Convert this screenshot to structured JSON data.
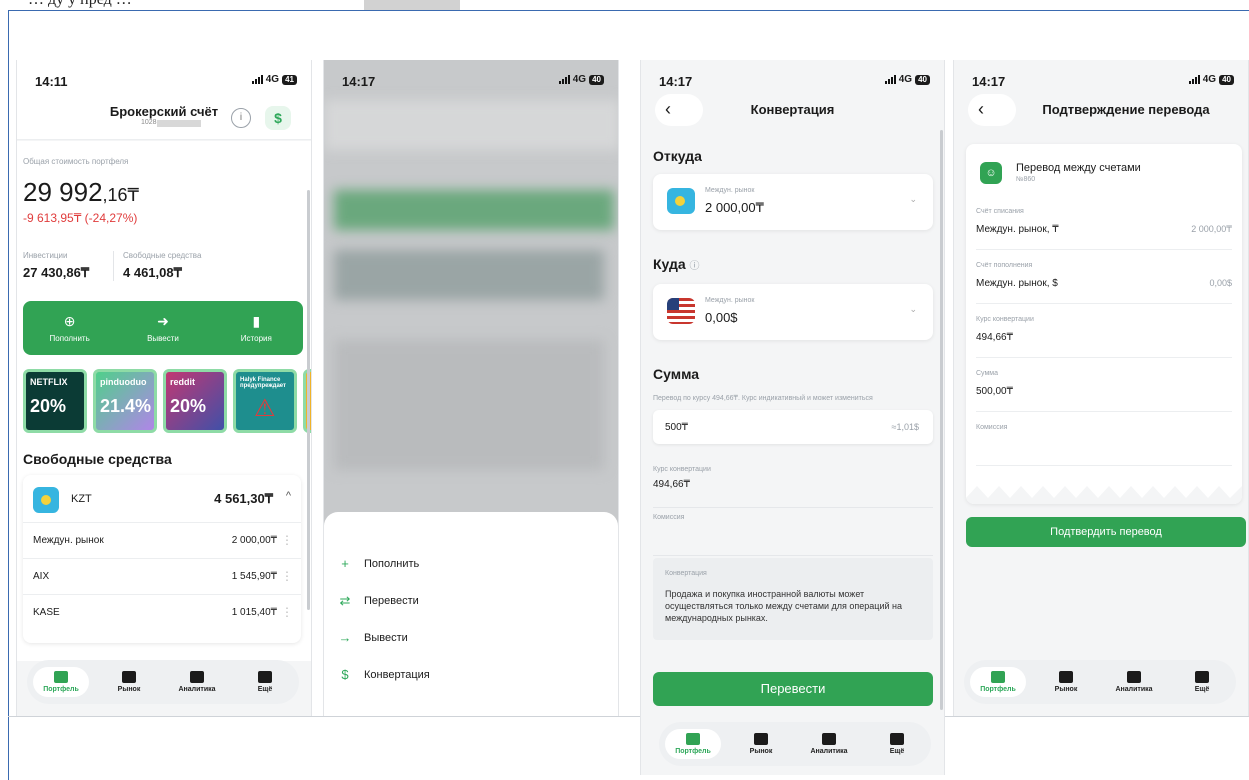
{
  "header_snippet": "… ду у пред …",
  "phone1": {
    "status_time": "14:11",
    "network": "4G",
    "battery": "41",
    "title": "Брокерский счёт",
    "account_prefix": "1028",
    "portfolio_label": "Общая стоимость портфеля",
    "portfolio_int": "29 992",
    "portfolio_dec": ",16₸",
    "portfolio_change": "-9 613,95₸ (-24,27%)",
    "investments_label": "Инвестиции",
    "investments_value": "27 430,86₸",
    "free_label": "Свободные средства",
    "free_value": "4 461,08₸",
    "actions": [
      {
        "icon": "plus-circle-icon",
        "label": "Пополнить"
      },
      {
        "icon": "arrow-right-circle-icon",
        "label": "Вывести"
      },
      {
        "icon": "document-icon",
        "label": "История"
      }
    ],
    "banners": [
      {
        "name": "NETFLIX",
        "percent": "20%"
      },
      {
        "name": "pinduoduo",
        "percent": "21.4%"
      },
      {
        "name": "reddit",
        "percent": "20%"
      },
      {
        "name": "Halyk Finance предупреждает",
        "percent": ""
      }
    ],
    "free_section_title": "Свободные средства",
    "currency_name": "KZT",
    "currency_total": "4 561,30₸",
    "markets": [
      {
        "name": "Междун. рынок",
        "value": "2 000,00₸"
      },
      {
        "name": "AIX",
        "value": "1 545,90₸"
      },
      {
        "name": "KASE",
        "value": "1 015,40₸"
      }
    ]
  },
  "tabs": [
    {
      "label": "Портфель",
      "icon": "briefcase-icon"
    },
    {
      "label": "Рынок",
      "icon": "chart-icon"
    },
    {
      "label": "Аналитика",
      "icon": "news-icon"
    },
    {
      "label": "Ещё",
      "icon": "grid-icon"
    }
  ],
  "phone2": {
    "status_time": "14:17",
    "network": "4G",
    "battery": "40",
    "menu": [
      {
        "icon": "plus-icon",
        "label": "Пополнить"
      },
      {
        "icon": "transfer-icon",
        "label": "Перевести"
      },
      {
        "icon": "arrow-right-icon",
        "label": "Вывести"
      },
      {
        "icon": "exchange-icon",
        "label": "Конвертация"
      }
    ]
  },
  "phone3": {
    "status_time": "14:17",
    "network": "4G",
    "battery": "40",
    "title": "Конвертация",
    "from_label": "Откуда",
    "from_market": "Междун. рынок",
    "from_value": "2 000,00₸",
    "to_label": "Куда",
    "to_market": "Междун. рынок",
    "to_value": "0,00$",
    "amount_label": "Сумма",
    "rate_note": "Перевод по курсу 494,66₸. Курс индикативный и может измениться",
    "amount_value": "500₸",
    "amount_converted": "≈1,01$",
    "rate_label": "Курс конвертации",
    "rate_value": "494,66₸",
    "fee_label": "Комиссия",
    "info_title": "Конвертация",
    "info_text": "Продажа и покупка иностранной валюты может осуществляться только между счетами для операций на международных рынках.",
    "submit_label": "Перевести"
  },
  "phone4": {
    "status_time": "14:17",
    "network": "4G",
    "battery": "40",
    "title": "Подтверждение перевода",
    "transfer_title": "Перевод между счетами",
    "transfer_number": "№860",
    "rows": [
      {
        "label": "Счёт списания",
        "left": "Междун. рынок, ₸",
        "right": "2 000,00₸"
      },
      {
        "label": "Счёт пополнения",
        "left": "Междун. рынок, $",
        "right": "0,00$"
      },
      {
        "label": "Курс конвертации",
        "left": "494,66₸",
        "right": ""
      },
      {
        "label": "Сумма",
        "left": "500,00₸",
        "right": ""
      },
      {
        "label": "Комиссия",
        "left": "",
        "right": ""
      }
    ],
    "confirm_label": "Подтвердить перевод"
  },
  "colors": {
    "accent": "#31a354",
    "loss": "#e03c3c"
  }
}
